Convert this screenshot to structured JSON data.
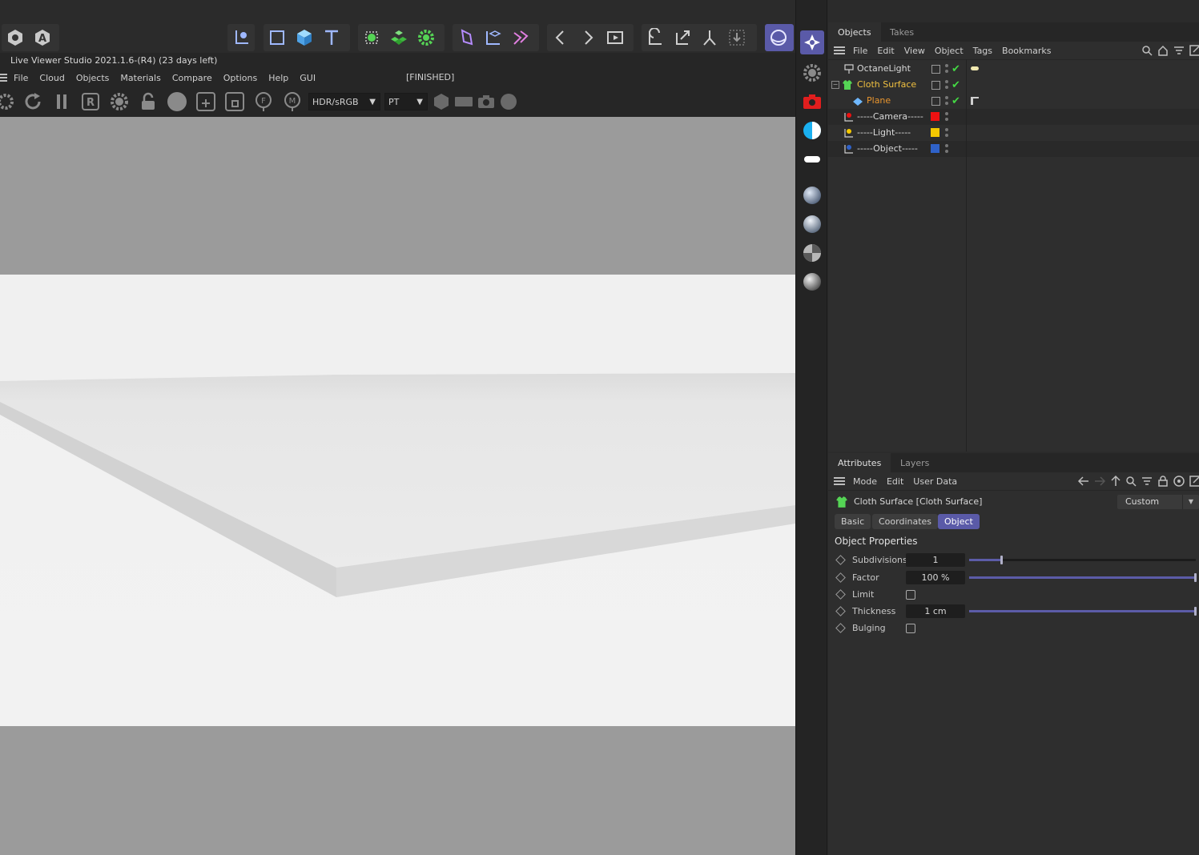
{
  "liveviewer": {
    "title": "Live Viewer Studio 2021.1.6-(R4) (23 days left)",
    "menu": [
      "File",
      "Cloud",
      "Objects",
      "Materials",
      "Compare",
      "Options",
      "Help",
      "GUI"
    ],
    "status": "[FINISHED]",
    "colorspace": "HDR/sRGB",
    "kernel": "PT"
  },
  "objects_panel": {
    "tabs": [
      "Objects",
      "Takes"
    ],
    "menu": [
      "File",
      "Edit",
      "View",
      "Object",
      "Tags",
      "Bookmarks"
    ],
    "items": [
      {
        "name": "OctaneLight",
        "color": "#d8d8d8"
      },
      {
        "name": "Cloth Surface",
        "color": "#f0c040"
      },
      {
        "name": "Plane",
        "color": "#e8952e"
      },
      {
        "name": "-----Camera-----",
        "color": "#d8d8d8",
        "swatch": "#ee1111"
      },
      {
        "name": "-----Light-----",
        "color": "#d8d8d8",
        "swatch": "#f5c800"
      },
      {
        "name": "-----Object-----",
        "color": "#d8d8d8",
        "swatch": "#2f62c9"
      }
    ]
  },
  "attributes_panel": {
    "tabs": [
      "Attributes",
      "Layers"
    ],
    "menu": [
      "Mode",
      "Edit",
      "User Data"
    ],
    "object_title": "Cloth Surface [Cloth Surface]",
    "preset": "Custom",
    "subtabs": [
      "Basic",
      "Coordinates",
      "Object"
    ],
    "section": "Object Properties",
    "properties": [
      {
        "label": "Subdivisions",
        "value": "1",
        "slider": 0.14
      },
      {
        "label": "Factor",
        "value": "100 %",
        "slider": 1.0
      },
      {
        "label": "Limit"
      },
      {
        "label": "Thickness",
        "value": "1 cm",
        "slider": 1.0
      },
      {
        "label": "Bulging"
      }
    ]
  },
  "accent": "#5a5aa8"
}
